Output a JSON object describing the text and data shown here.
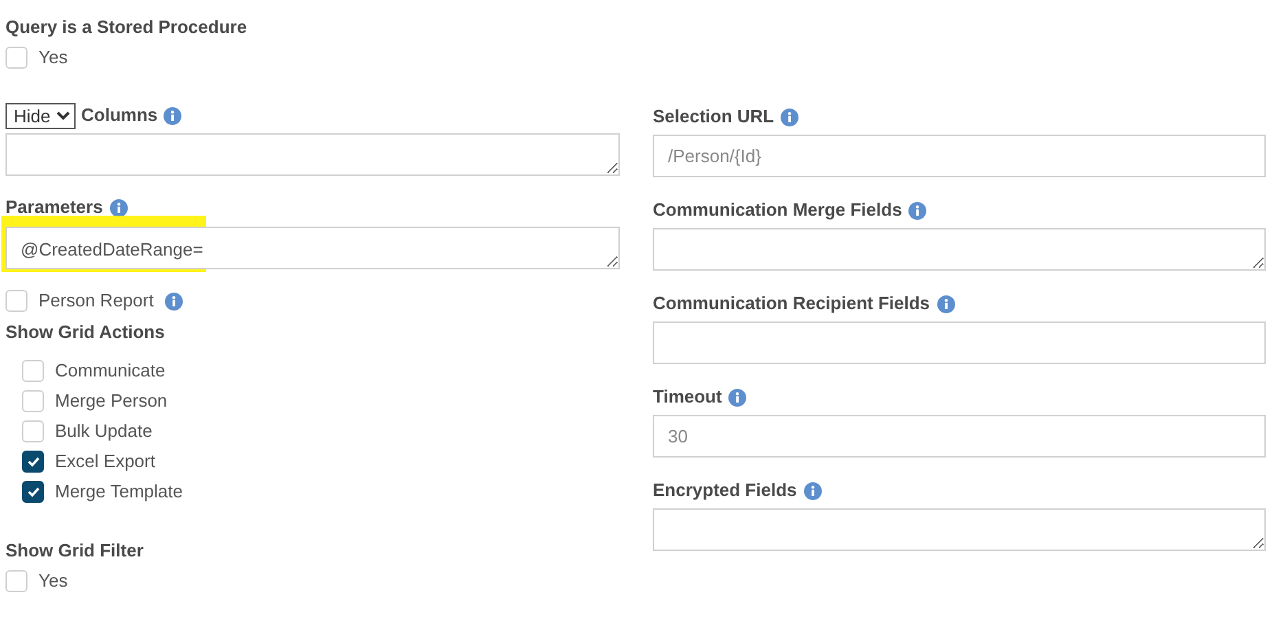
{
  "stored_procedure": {
    "label": "Query is a Stored Procedure",
    "option": {
      "label": "Yes",
      "checked": false
    }
  },
  "columns": {
    "mode": "Hide",
    "label": "Columns"
  },
  "parameters": {
    "label": "Parameters",
    "value": "@CreatedDateRange=",
    "highlighted": true
  },
  "person_report": {
    "label": "Person Report",
    "checked": false
  },
  "grid_actions": {
    "label": "Show Grid Actions",
    "items": [
      {
        "label": "Communicate",
        "checked": false
      },
      {
        "label": "Merge Person",
        "checked": false
      },
      {
        "label": "Bulk Update",
        "checked": false
      },
      {
        "label": "Excel Export",
        "checked": true
      },
      {
        "label": "Merge Template",
        "checked": true
      }
    ]
  },
  "grid_filter": {
    "label": "Show Grid Filter",
    "option": {
      "label": "Yes",
      "checked": false
    }
  },
  "right_fields": [
    {
      "label": "Selection URL",
      "kind": "input",
      "placeholder": "/Person/{Id}"
    },
    {
      "label": "Communication Merge Fields",
      "kind": "textarea"
    },
    {
      "label": "Communication Recipient Fields",
      "kind": "input"
    },
    {
      "label": "Timeout",
      "kind": "input",
      "placeholder": "30"
    },
    {
      "label": "Encrypted Fields",
      "kind": "textarea"
    }
  ]
}
